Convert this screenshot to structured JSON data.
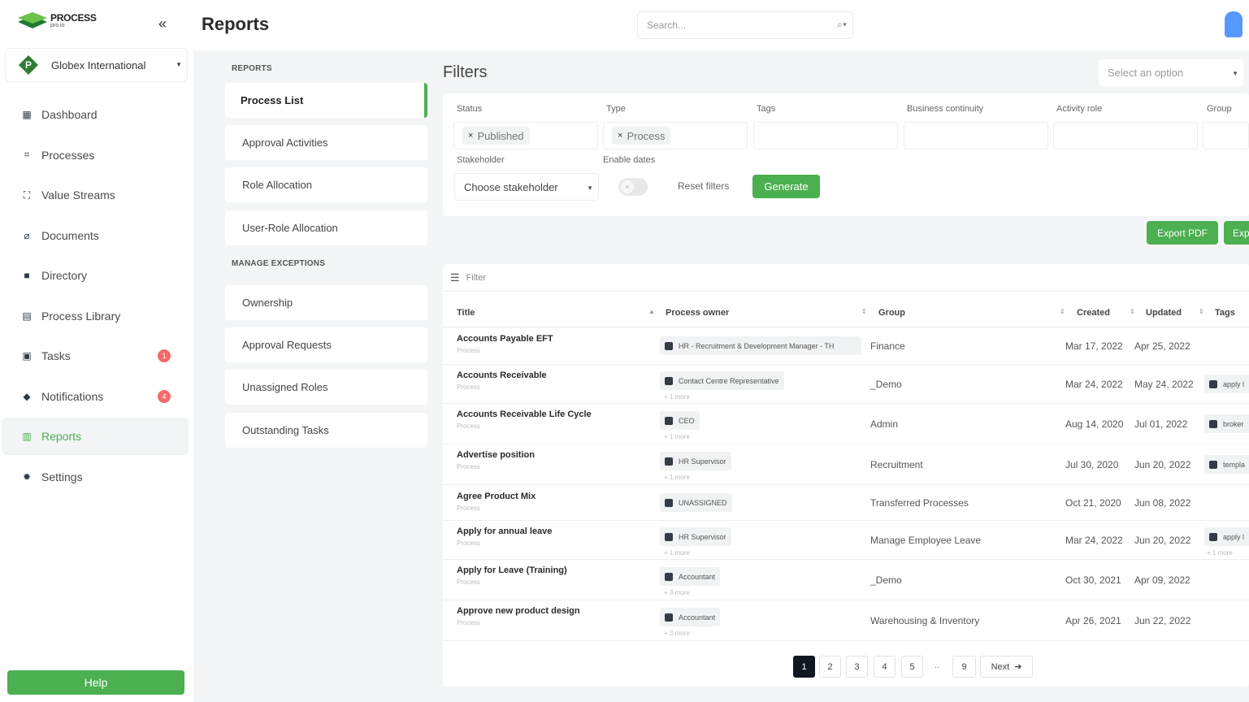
{
  "brand": {
    "line1": "PROCESS",
    "line2": "pro.io"
  },
  "org": {
    "initial": "P",
    "name": "Globex International"
  },
  "nav": [
    {
      "label": "Dashboard",
      "icon": "dashboard-icon",
      "glyph": "▦"
    },
    {
      "label": "Processes",
      "icon": "processes-icon",
      "glyph": "⌗"
    },
    {
      "label": "Value Streams",
      "icon": "value-streams-icon",
      "glyph": "⛶"
    },
    {
      "label": "Documents",
      "icon": "paperclip-icon",
      "glyph": "⌀"
    },
    {
      "label": "Directory",
      "icon": "folder-icon",
      "glyph": "■"
    },
    {
      "label": "Process Library",
      "icon": "book-icon",
      "glyph": "▤"
    },
    {
      "label": "Tasks",
      "icon": "tasks-icon",
      "glyph": "▣",
      "badge": "1"
    },
    {
      "label": "Notifications",
      "icon": "notification-icon",
      "glyph": "◆",
      "badge": "4"
    },
    {
      "label": "Reports",
      "icon": "reports-icon",
      "glyph": "▥",
      "active": true
    },
    {
      "label": "Settings",
      "icon": "settings-icon",
      "glyph": "✹"
    }
  ],
  "help_label": "Help",
  "header": {
    "title": "Reports",
    "search_placeholder": "Search..."
  },
  "subnav": {
    "reports_heading": "REPORTS",
    "reports": [
      "Process List",
      "Approval Activities",
      "Role Allocation",
      "User-Role Allocation"
    ],
    "exceptions_heading": "MANAGE EXCEPTIONS",
    "exceptions": [
      "Ownership",
      "Approval Requests",
      "Unassigned Roles",
      "Outstanding Tasks"
    ]
  },
  "filters": {
    "title": "Filters",
    "select_placeholder": "Select an option",
    "labels": {
      "status": "Status",
      "type": "Type",
      "tags": "Tags",
      "business_continuity": "Business continuity",
      "activity_role": "Activity role",
      "group": "Group",
      "stakeholder": "Stakeholder",
      "enable_dates": "Enable dates"
    },
    "status_chip": "Published",
    "type_chip": "Process",
    "stakeholder_placeholder": "Choose stakeholder",
    "reset_label": "Reset filters",
    "generate_label": "Generate"
  },
  "export": {
    "pdf": "Export PDF",
    "other": "Exp"
  },
  "table": {
    "filter_placeholder": "Filter",
    "columns": {
      "title": "Title",
      "owner": "Process owner",
      "group": "Group",
      "created": "Created",
      "updated": "Updated",
      "tags": "Tags"
    },
    "rows": [
      {
        "title": "Accounts Payable EFT",
        "sub": "Process",
        "owner": "HR - Recruitment & Development Manager - TH",
        "owner_more": "",
        "group": "Finance",
        "created": "Mar 17, 2022",
        "updated": "Apr 25, 2022",
        "tag": "",
        "tag_more": ""
      },
      {
        "title": "Accounts Receivable",
        "sub": "Process",
        "owner": "Contact Centre Representative",
        "owner_more": "+ 1 more",
        "group": "_Demo",
        "created": "Mar 24, 2022",
        "updated": "May 24, 2022",
        "tag": "apply l",
        "tag_more": ""
      },
      {
        "title": "Accounts Receivable Life Cycle",
        "sub": "Process",
        "owner": "CEO",
        "owner_more": "+ 1 more",
        "group": "Admin",
        "created": "Aug 14, 2020",
        "updated": "Jul 01, 2022",
        "tag": "broker",
        "tag_more": ""
      },
      {
        "title": "Advertise position",
        "sub": "Process",
        "owner": "HR Supervisor",
        "owner_more": "+ 1 more",
        "group": "Recruitment",
        "created": "Jul 30, 2020",
        "updated": "Jun 20, 2022",
        "tag": "templa",
        "tag_more": ""
      },
      {
        "title": "Agree Product Mix",
        "sub": "Process",
        "owner": "UNASSIGNED",
        "owner_more": "",
        "group": "Transferred Processes",
        "created": "Oct 21, 2020",
        "updated": "Jun 08, 2022",
        "tag": "",
        "tag_more": ""
      },
      {
        "title": "Apply for annual leave",
        "sub": "Process",
        "owner": "HR Supervisor",
        "owner_more": "+ 1 more",
        "group": "Manage Employee Leave",
        "created": "Mar 24, 2022",
        "updated": "Jun 20, 2022",
        "tag": "apply l",
        "tag_more": "+ 1 more"
      },
      {
        "title": "Apply for Leave (Training)",
        "sub": "Process",
        "owner": "Accountant",
        "owner_more": "+ 3 more",
        "group": "_Demo",
        "created": "Oct 30, 2021",
        "updated": "Apr 09, 2022",
        "tag": "",
        "tag_more": ""
      },
      {
        "title": "Approve new product design",
        "sub": "Process",
        "owner": "Accountant",
        "owner_more": "+ 3 more",
        "group": "Warehousing & Inventory",
        "created": "Apr 26, 2021",
        "updated": "Jun 22, 2022",
        "tag": "",
        "tag_more": ""
      }
    ]
  },
  "pagination": {
    "pages": [
      "1",
      "2",
      "3",
      "4",
      "5"
    ],
    "ellipsis": "..",
    "last": "9",
    "next": "Next"
  }
}
